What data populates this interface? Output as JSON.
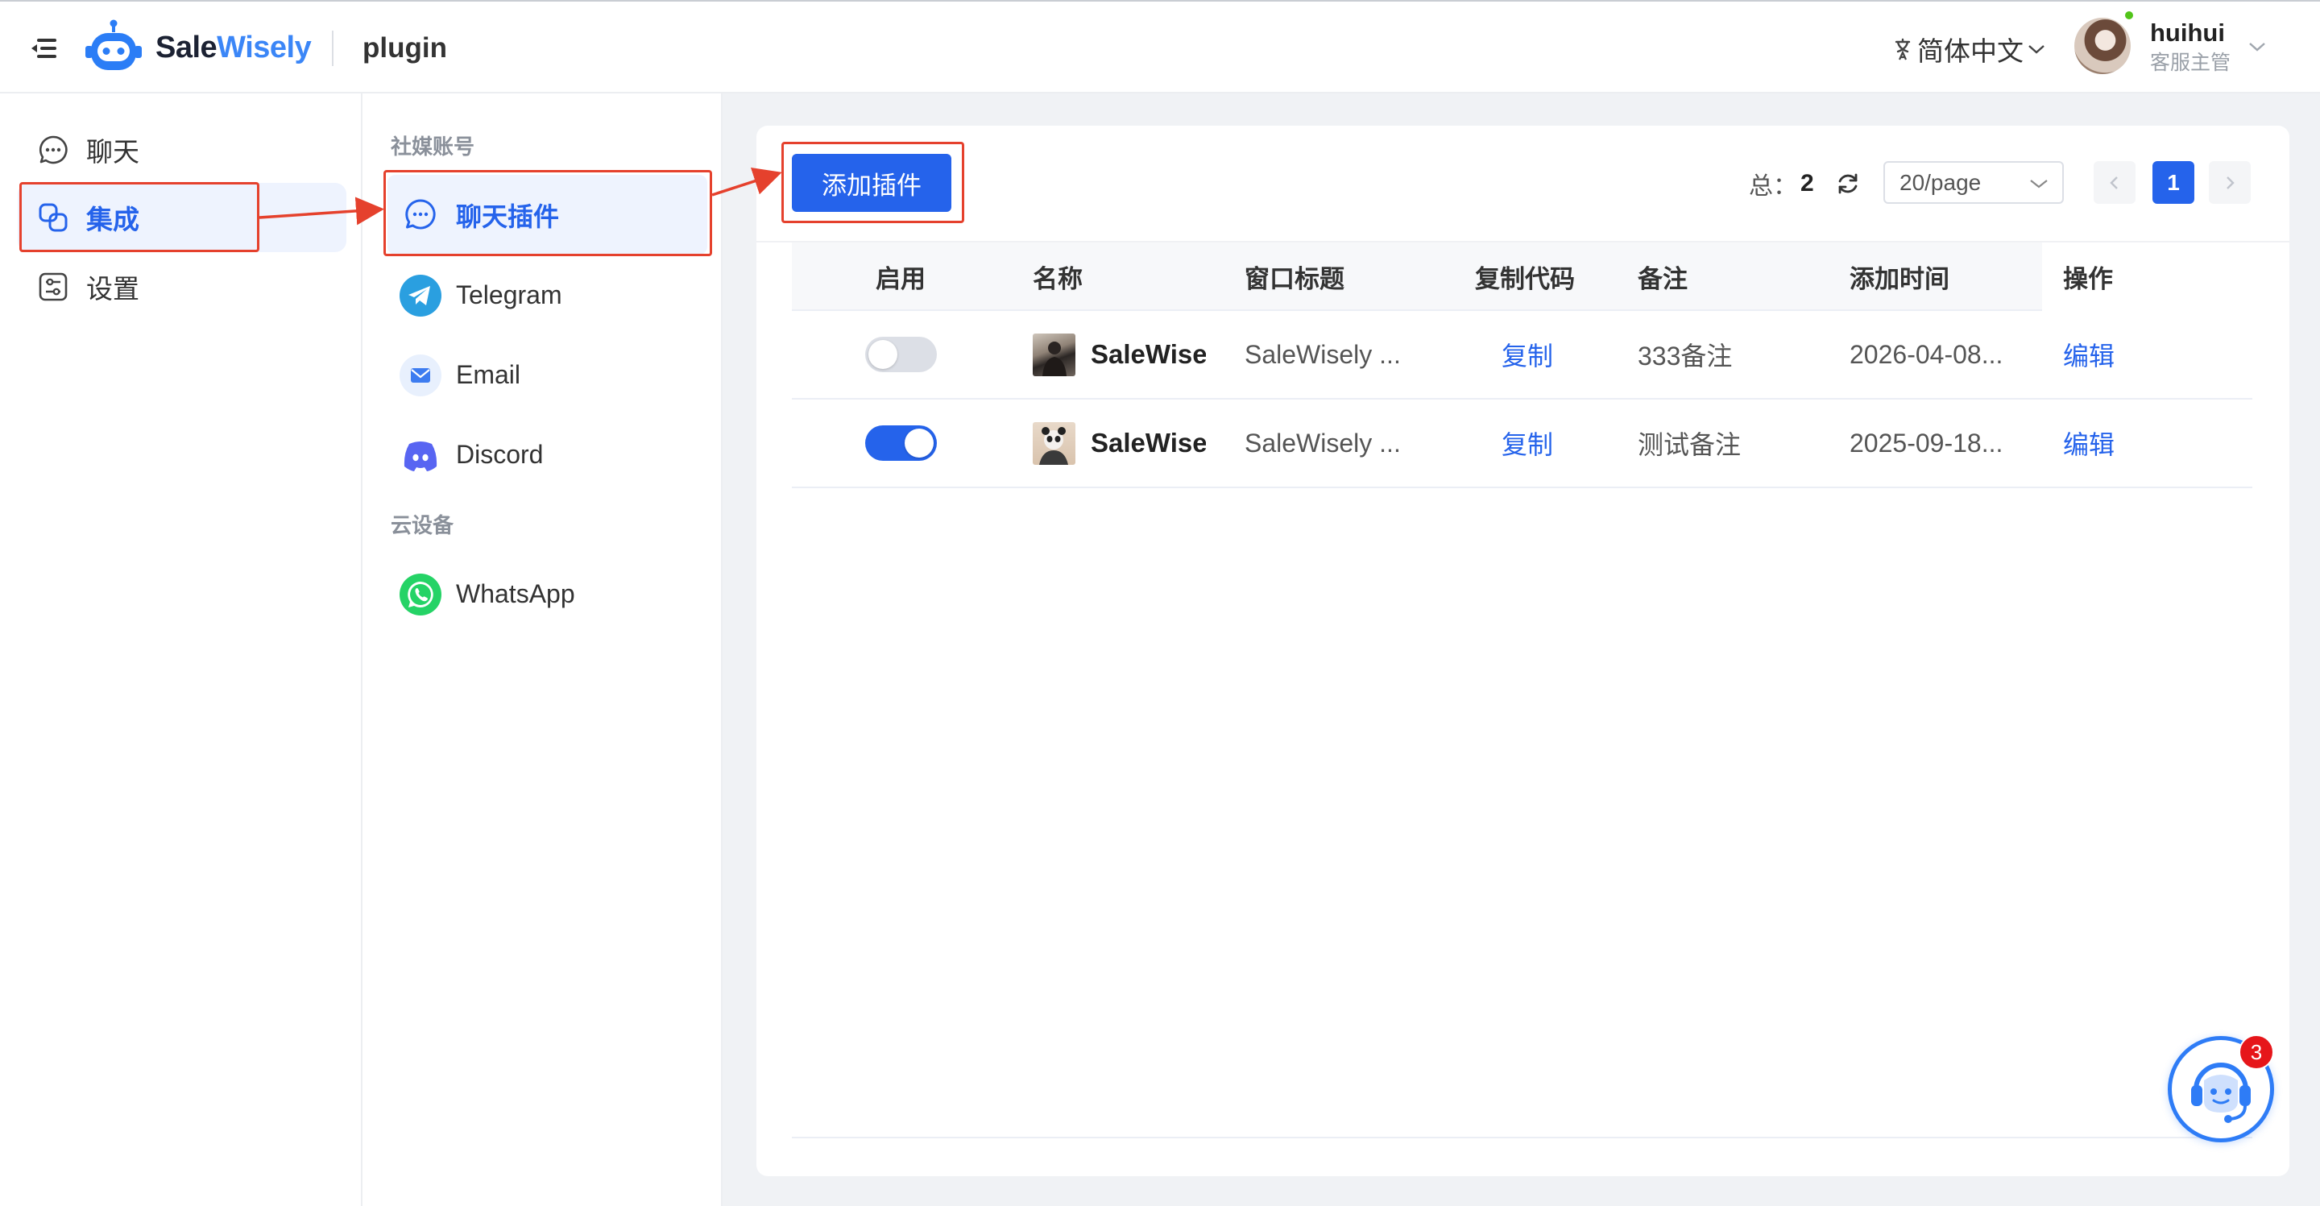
{
  "header": {
    "menu_icon": "menu-icon",
    "brand_sale": "Sale",
    "brand_wisely": "Wisely",
    "page_name": "plugin",
    "language": "简体中文",
    "user_name": "huihui",
    "user_role": "客服主管"
  },
  "sidebar": {
    "items": [
      {
        "label": "聊天",
        "icon": "chat-icon"
      },
      {
        "label": "集成",
        "icon": "integration-icon",
        "active": true
      },
      {
        "label": "设置",
        "icon": "settings-icon"
      }
    ]
  },
  "subnav": {
    "section_social": "社媒账号",
    "section_cloud": "云设备",
    "items": [
      {
        "label": "聊天插件",
        "icon": "chat-plugin-icon",
        "active": true
      },
      {
        "label": "Telegram",
        "icon": "telegram-icon"
      },
      {
        "label": "Email",
        "icon": "email-icon"
      },
      {
        "label": "Discord",
        "icon": "discord-icon"
      },
      {
        "label": "WhatsApp",
        "icon": "whatsapp-icon"
      }
    ]
  },
  "toolbar": {
    "add_button": "添加插件",
    "total_label": "总：",
    "total": "2",
    "page_size": "20/page",
    "current_page": "1"
  },
  "table": {
    "columns": [
      "启用",
      "名称",
      "窗口标题",
      "复制代码",
      "备注",
      "添加时间",
      "操作"
    ],
    "rows": [
      {
        "enabled": false,
        "name": "SaleWisely",
        "window_title": "SaleWisely ...",
        "copy": "复制",
        "note": "333备注",
        "added": "2026-04-08...",
        "action": "编辑"
      },
      {
        "enabled": true,
        "name": "SaleWisely",
        "window_title": "SaleWisely ...",
        "copy": "复制",
        "note": "测试备注",
        "added": "2025-09-18...",
        "action": "编辑"
      }
    ]
  },
  "support": {
    "badge": "3",
    "icon": "customer-support-icon"
  },
  "colors": {
    "primary": "#2563eb",
    "highlight_red": "#e5412d",
    "active_bg": "#eef3fe",
    "page_bg": "#f0f2f5"
  }
}
